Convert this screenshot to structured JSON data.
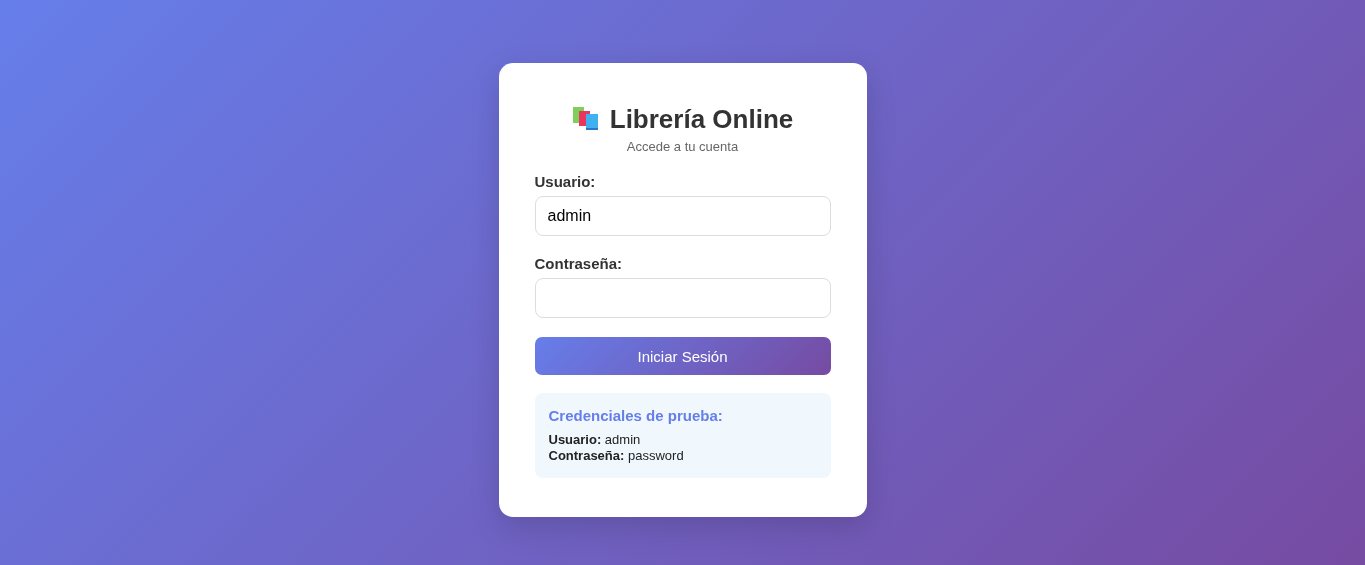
{
  "header": {
    "title": "Librería Online",
    "subtitle": "Accede a tu cuenta"
  },
  "fields": [
    {
      "label": "Usuario:",
      "value": "admin"
    },
    {
      "label": "Contraseña:"
    }
  ],
  "button": "Iniciar Sesión",
  "credentials": {
    "title": "Credenciales de prueba:",
    "lines": [
      "**Usuario:** admin",
      "**Contraseña:** password"
    ]
  }
}
